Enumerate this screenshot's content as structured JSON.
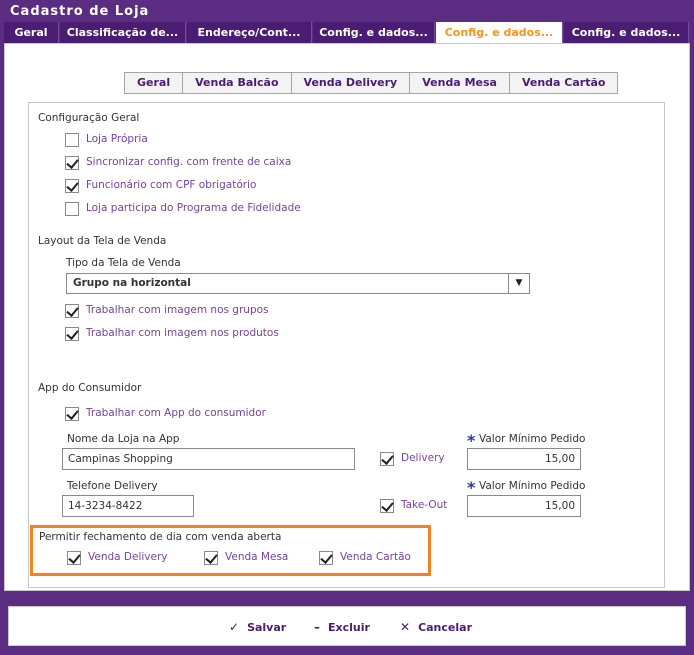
{
  "window": {
    "title": "Cadastro de Loja"
  },
  "tabs": [
    {
      "label": "Geral"
    },
    {
      "label": "Classificação de..."
    },
    {
      "label": "Endereço/Cont..."
    },
    {
      "label": "Config. e dados..."
    },
    {
      "label": "Config. e dados...",
      "active": true
    },
    {
      "label": "Config. e dados..."
    }
  ],
  "subtabs": [
    {
      "label": "Geral"
    },
    {
      "label": "Venda Balcão"
    },
    {
      "label": "Venda Delivery"
    },
    {
      "label": "Venda Mesa"
    },
    {
      "label": "Venda Cartão"
    }
  ],
  "config_geral": {
    "title": "Configuração Geral",
    "items": [
      {
        "label": "Loja Própria",
        "checked": false
      },
      {
        "label": "Sincronizar config. com frente de caixa",
        "checked": true
      },
      {
        "label": "Funcionário com CPF obrigatório",
        "checked": true
      },
      {
        "label": "Loja participa do Programa de Fidelidade",
        "checked": false
      }
    ]
  },
  "layout": {
    "title": "Layout da Tela de Venda",
    "tipo_label": "Tipo da Tela de Venda",
    "tipo_value": "Grupo na horizontal",
    "items": [
      {
        "label": "Trabalhar com imagem nos grupos",
        "checked": true
      },
      {
        "label": "Trabalhar com imagem nos produtos",
        "checked": true
      }
    ]
  },
  "app": {
    "title": "App do Consumidor",
    "use_app_label": "Trabalhar com App do consumidor",
    "use_app_checked": true,
    "nome_label": "Nome da Loja na App",
    "nome_value": "Campinas Shopping",
    "delivery_label": "Delivery",
    "delivery_checked": true,
    "valor_label_1": "Valor Mínimo Pedido",
    "valor_1": "15,00",
    "telefone_label": "Telefone Delivery",
    "telefone_value": "14-3234-8422",
    "takeout_label": "Take-Out",
    "takeout_checked": true,
    "valor_label_2": "Valor Mínimo Pedido",
    "valor_2": "15,00"
  },
  "fechamento": {
    "title": "Permitir fechamento de dia com venda aberta",
    "items": [
      {
        "label": "Venda Delivery",
        "checked": true
      },
      {
        "label": "Venda Mesa",
        "checked": true
      },
      {
        "label": "Venda Cartão",
        "checked": true
      }
    ]
  },
  "footer": {
    "save": "Salvar",
    "delete": "Excluir",
    "cancel": "Cancelar"
  },
  "colors": {
    "brand": "#5a2d82",
    "active_tab_text": "#f7941d",
    "highlight": "#f58220",
    "checkbox_label": "#7a3fa0"
  }
}
